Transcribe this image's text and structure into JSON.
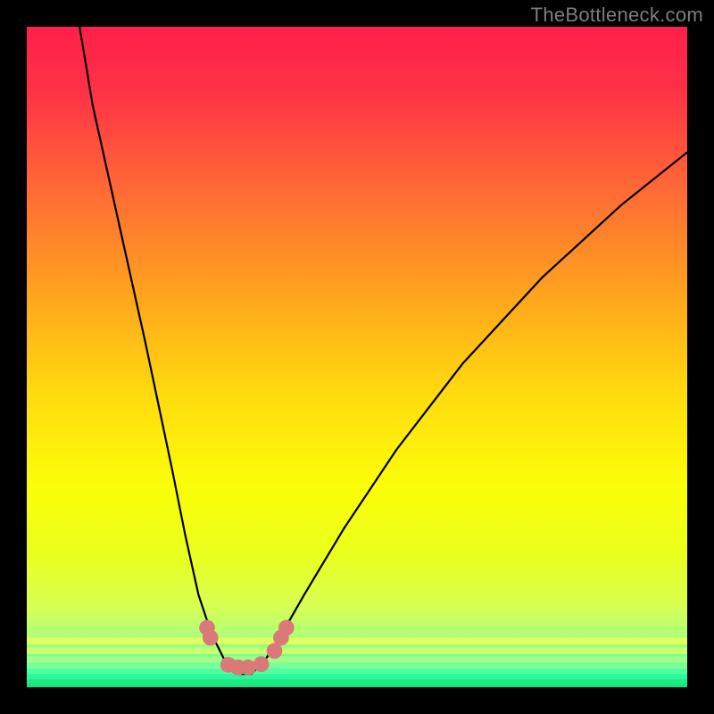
{
  "watermark": "TheBottleneck.com",
  "chart_data": {
    "type": "line",
    "title": "",
    "xlabel": "",
    "ylabel": "",
    "xlim": [
      0,
      100
    ],
    "ylim": [
      0,
      100
    ],
    "grid": false,
    "legend": false,
    "series": [
      {
        "name": "bottleneck-curve",
        "x": [
          8,
          10,
          14,
          18,
          22,
          24,
          26,
          28,
          30,
          32,
          33,
          34,
          36,
          38,
          42,
          48,
          56,
          66,
          78,
          90,
          100
        ],
        "y": [
          100,
          88,
          70,
          52,
          33,
          23,
          14,
          8,
          4,
          2,
          2,
          2,
          4,
          7,
          14,
          24,
          36,
          49,
          62,
          73,
          81
        ]
      }
    ],
    "markers": [
      {
        "name": "threshold-marker",
        "x": 27.3,
        "y": 9.0
      },
      {
        "name": "threshold-marker",
        "x": 27.8,
        "y": 7.5
      },
      {
        "name": "threshold-marker",
        "x": 30.5,
        "y": 3.4
      },
      {
        "name": "threshold-marker",
        "x": 32.0,
        "y": 3.0
      },
      {
        "name": "threshold-marker",
        "x": 33.5,
        "y": 3.0
      },
      {
        "name": "threshold-marker",
        "x": 35.5,
        "y": 3.5
      },
      {
        "name": "threshold-marker",
        "x": 37.5,
        "y": 5.5
      },
      {
        "name": "threshold-marker",
        "x": 38.5,
        "y": 7.5
      },
      {
        "name": "threshold-marker",
        "x": 39.3,
        "y": 9.0
      }
    ],
    "background_gradient": {
      "stops": [
        {
          "offset": 0.0,
          "color": "#ff1f4a"
        },
        {
          "offset": 0.1,
          "color": "#ff3246"
        },
        {
          "offset": 0.25,
          "color": "#ff6b35"
        },
        {
          "offset": 0.4,
          "color": "#ffa21e"
        },
        {
          "offset": 0.55,
          "color": "#ffd90f"
        },
        {
          "offset": 0.7,
          "color": "#fbff08"
        },
        {
          "offset": 0.8,
          "color": "#eaff1e"
        },
        {
          "offset": 0.88,
          "color": "#d6ff55"
        },
        {
          "offset": 0.93,
          "color": "#a6ff7f"
        },
        {
          "offset": 0.97,
          "color": "#4fff9e"
        },
        {
          "offset": 1.0,
          "color": "#12e97a"
        }
      ]
    },
    "near_bottom_bands": [
      {
        "y": 92.5,
        "color": "#e0ff5e"
      },
      {
        "y": 94.0,
        "color": "#c9ff6e"
      },
      {
        "y": 95.3,
        "color": "#9fff88"
      },
      {
        "y": 96.3,
        "color": "#78ff99"
      },
      {
        "y": 97.2,
        "color": "#4dffa3"
      },
      {
        "y": 98.0,
        "color": "#2ef79a"
      },
      {
        "y": 98.8,
        "color": "#1cea84"
      },
      {
        "y": 99.6,
        "color": "#15e27c"
      }
    ],
    "colors": {
      "curve_stroke": "#000000",
      "marker_fill": "#d97a78",
      "frame_bg": "#000000",
      "watermark": "#7d7d7d"
    }
  }
}
